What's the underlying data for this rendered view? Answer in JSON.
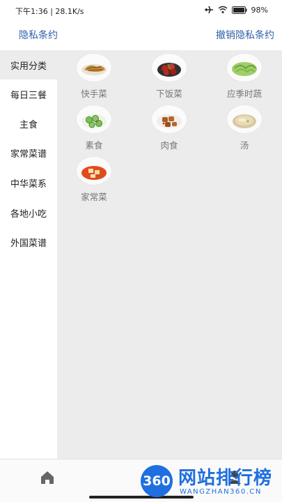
{
  "status_bar": {
    "time_speed": "下午1:36 | 28.1K/s",
    "battery": "98%"
  },
  "header": {
    "left_link": "隐私条约",
    "right_link": "撤销隐私条约"
  },
  "sidebar": {
    "items": [
      {
        "label": "实用分类",
        "active": true
      },
      {
        "label": "每日三餐",
        "active": false
      },
      {
        "label": "主食",
        "active": false
      },
      {
        "label": "家常菜谱",
        "active": false
      },
      {
        "label": "中华菜系",
        "active": false
      },
      {
        "label": "各地小吃",
        "active": false
      },
      {
        "label": "外国菜谱",
        "active": false
      }
    ]
  },
  "categories": [
    {
      "label": "快手菜",
      "icon": "stir-fry-dish-icon"
    },
    {
      "label": "下饭菜",
      "icon": "red-braised-dish-icon"
    },
    {
      "label": "应季时蔬",
      "icon": "green-vegetable-dish-icon"
    },
    {
      "label": "素食",
      "icon": "cucumber-dish-icon"
    },
    {
      "label": "肉食",
      "icon": "meat-dish-icon"
    },
    {
      "label": "汤",
      "icon": "soup-bowl-icon"
    },
    {
      "label": "家常菜",
      "icon": "tofu-dish-icon"
    }
  ],
  "bottom_bar": {
    "tabs": [
      {
        "icon": "home-icon"
      },
      {
        "icon": "user-icon"
      }
    ]
  },
  "watermark": {
    "badge": "360",
    "title": "网站排行榜",
    "subtitle": "WANGZHAN360.CN"
  },
  "colors": {
    "accent": "#2f5fa8",
    "sidebar_active": "#ececec",
    "content_bg": "#ececec",
    "label_gray": "#777777"
  }
}
